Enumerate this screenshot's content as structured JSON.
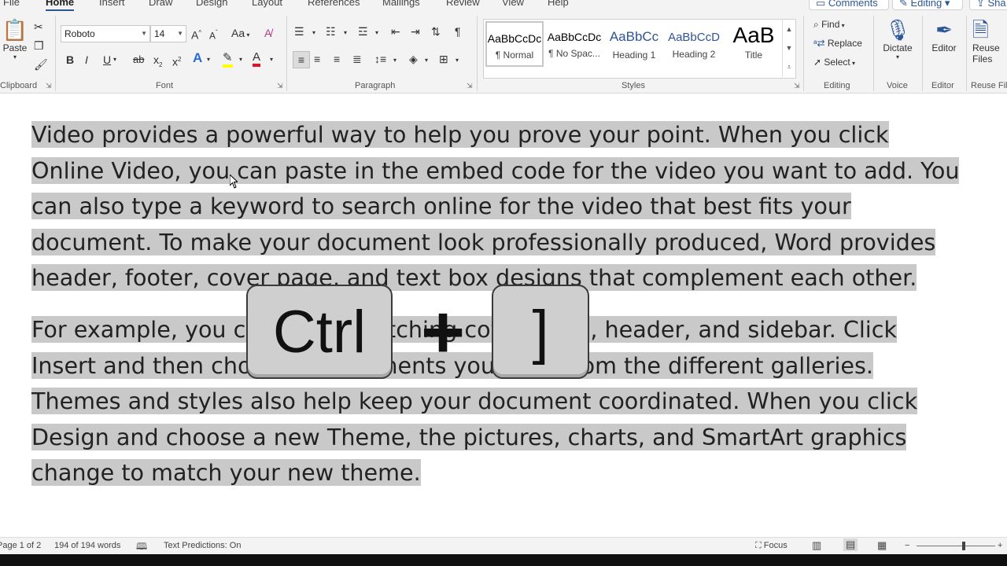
{
  "tabs": {
    "file": "File",
    "home": "Home",
    "insert": "Insert",
    "draw": "Draw",
    "design": "Design",
    "layout": "Layout",
    "references": "References",
    "mailings": "Mailings",
    "review": "Review",
    "view": "View",
    "help": "Help",
    "comments": "Comments",
    "editing": "Editing",
    "share": "Sha"
  },
  "ribbon": {
    "clipboard": {
      "paste": "Paste",
      "label": "Clipboard"
    },
    "font": {
      "name": "Roboto",
      "size": "14",
      "label": "Font",
      "grow": "A",
      "shrink": "A",
      "case": "Aa",
      "bold": "B",
      "italic": "I",
      "underline": "U",
      "strike": "ab",
      "subscript": "x",
      "superscript": "x",
      "effects": "A",
      "color": "A"
    },
    "paragraph": {
      "label": "Paragraph",
      "pilcrow": "¶"
    },
    "styles": {
      "label": "Styles",
      "items": [
        {
          "sample": "AaBbCcDc",
          "name": "¶ Normal"
        },
        {
          "sample": "AaBbCcDc",
          "name": "¶ No Spac..."
        },
        {
          "sample": "AaBbCc",
          "name": "Heading 1"
        },
        {
          "sample": "AaBbCcD",
          "name": "Heading 2"
        },
        {
          "sample": "AaB",
          "name": "Title"
        }
      ]
    },
    "editing": {
      "find": "Find",
      "replace": "Replace",
      "select": "Select",
      "label": "Editing"
    },
    "voice": {
      "dictate": "Dictate",
      "label": "Voice"
    },
    "editor": {
      "editor": "Editor",
      "label": "Editor"
    },
    "reuse": {
      "line1": "Reuse",
      "line2": "Files",
      "label": "Reuse Files"
    }
  },
  "document": {
    "paragraphs": [
      "Video provides a powerful way to help you prove your point. When you click Online Video, you can paste in the embed code for the video you want to add. You can also type a keyword to search online for the video that best fits your document. To make your document look professionally produced, Word provides header, footer, cover page, and text box designs that complement each other.",
      "For example, you can add a matching cover page, header, and sidebar. Click Insert and then choose the elements you want from the different galleries. Themes and styles also help keep your document coordinated. When you click Design and choose a new Theme, the pictures, charts, and SmartArt graphics change to match your new theme."
    ]
  },
  "overlay": {
    "key1": "Ctrl",
    "plus": "+",
    "key2": "]"
  },
  "status": {
    "page": "Page 1 of 2",
    "words": "194 of 194 words",
    "predictions": "Text Predictions: On",
    "focus": "Focus"
  },
  "colors": {
    "accent": "#2b579a",
    "highlight_color": "#ffff00",
    "font_color": "#e81123",
    "selection": "#c9c9c9"
  }
}
